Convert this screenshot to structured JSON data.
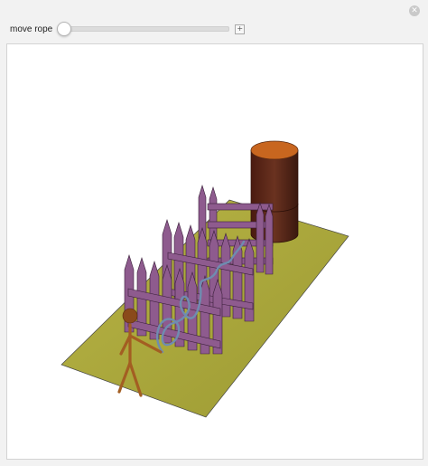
{
  "controls": {
    "slider_label": "move rope",
    "slider_value": 0,
    "close_icon": "close-icon",
    "plus_icon": "plus-icon"
  },
  "scene": {
    "ground_color": "#aaa83a",
    "fence_color": "#8e5b8e",
    "barrel_color": "#5b2718",
    "barrel_top_color": "#c8661f",
    "rope_color": "#6f8cb0",
    "figure_color": "#a35e22"
  }
}
